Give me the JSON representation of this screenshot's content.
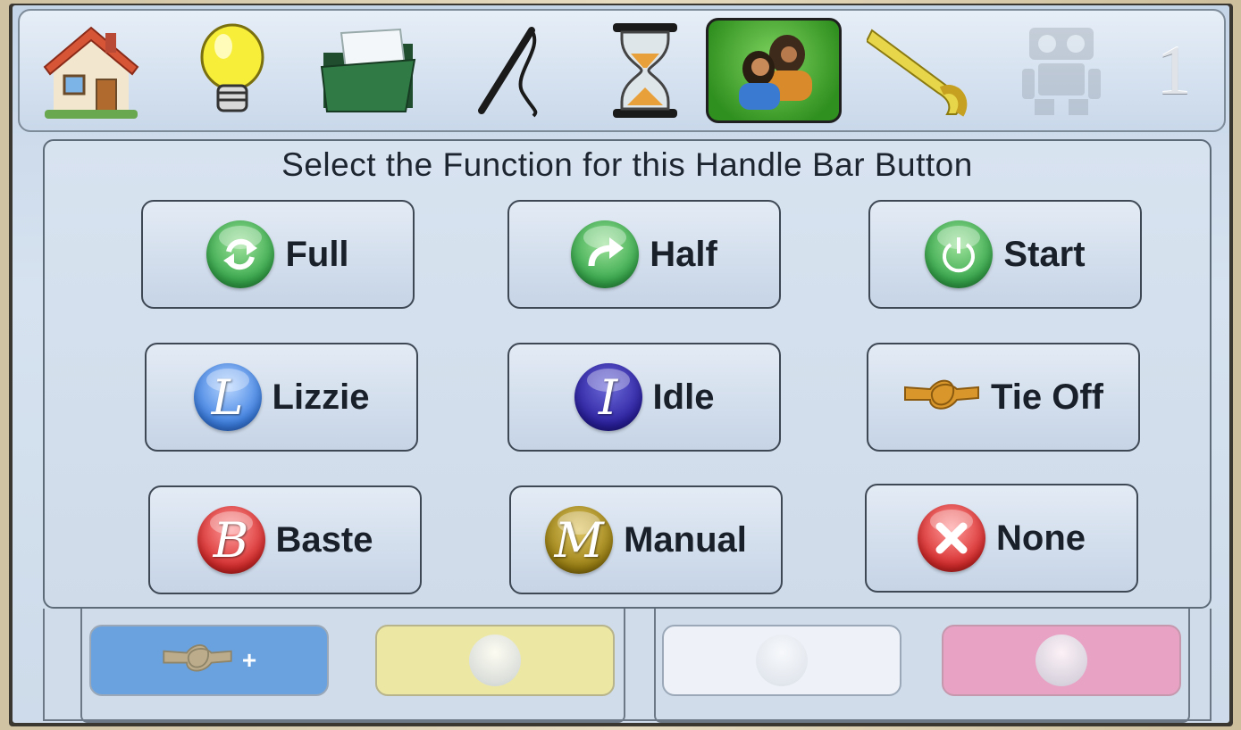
{
  "toolbar": {
    "items": [
      {
        "icon": "house-icon"
      },
      {
        "icon": "lightbulb-icon"
      },
      {
        "icon": "folder-icon"
      },
      {
        "icon": "needle-icon"
      },
      {
        "icon": "hourglass-icon"
      },
      {
        "icon": "users-icon",
        "active": true
      },
      {
        "icon": "measuring-tape-icon"
      },
      {
        "icon": "robot-icon",
        "disabled": true
      }
    ],
    "page_number": "1"
  },
  "main": {
    "title": "Select the Function for this Handle Bar Button",
    "buttons": [
      {
        "label": "Full",
        "icon": "cycle-arrows-icon",
        "color": "#35a64a"
      },
      {
        "label": "Half",
        "icon": "forward-arrow-icon",
        "color": "#35a64a"
      },
      {
        "label": "Start",
        "icon": "power-icon",
        "color": "#35a64a"
      },
      {
        "label": "Lizzie",
        "icon": "letter-l-icon",
        "letter": "L",
        "color": "#3a7de0"
      },
      {
        "label": "Idle",
        "icon": "letter-i-icon",
        "letter": "I",
        "color": "#2a1f9e"
      },
      {
        "label": "Tie Off",
        "icon": "knot-icon",
        "color": "#d9962a"
      },
      {
        "label": "Baste",
        "icon": "letter-b-icon",
        "letter": "B",
        "color": "#d62a2a"
      },
      {
        "label": "Manual",
        "icon": "letter-m-icon",
        "letter": "M",
        "color": "#9a7f12"
      },
      {
        "label": "None",
        "icon": "close-x-icon",
        "color": "#d62a2a"
      }
    ]
  },
  "handlebar": {
    "slots": [
      {
        "icon": "knot-icon",
        "extra": "+",
        "color": "#6aa2e0"
      },
      {
        "icon": "forward-arrow-icon",
        "color": "#ece8a4"
      },
      {
        "icon": "cycle-arrows-icon",
        "color": "#eef2f8"
      },
      {
        "icon": "power-icon",
        "color": "#e8a2c4"
      }
    ]
  }
}
